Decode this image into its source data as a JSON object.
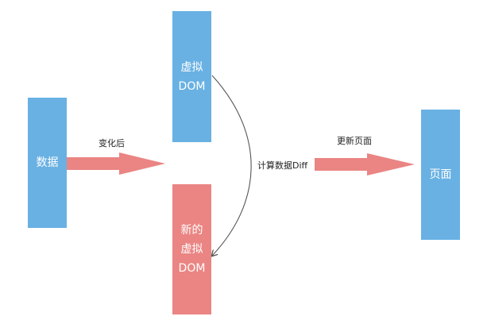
{
  "colors": {
    "blue": "#69b1e3",
    "red": "#ea8583",
    "arrow_red": "#ea8583",
    "curve": "#555555"
  },
  "boxes": {
    "data": {
      "line1": "数据"
    },
    "virtual_dom": {
      "line1": "虚拟",
      "line2": "DOM"
    },
    "new_virtual_dom": {
      "line1": "新的",
      "line2": "虚拟",
      "line3": "DOM"
    },
    "page": {
      "line1": "页面"
    }
  },
  "labels": {
    "after_change": "变化后",
    "compute_diff": "计算数据Diff",
    "update_page": "更新页面"
  }
}
